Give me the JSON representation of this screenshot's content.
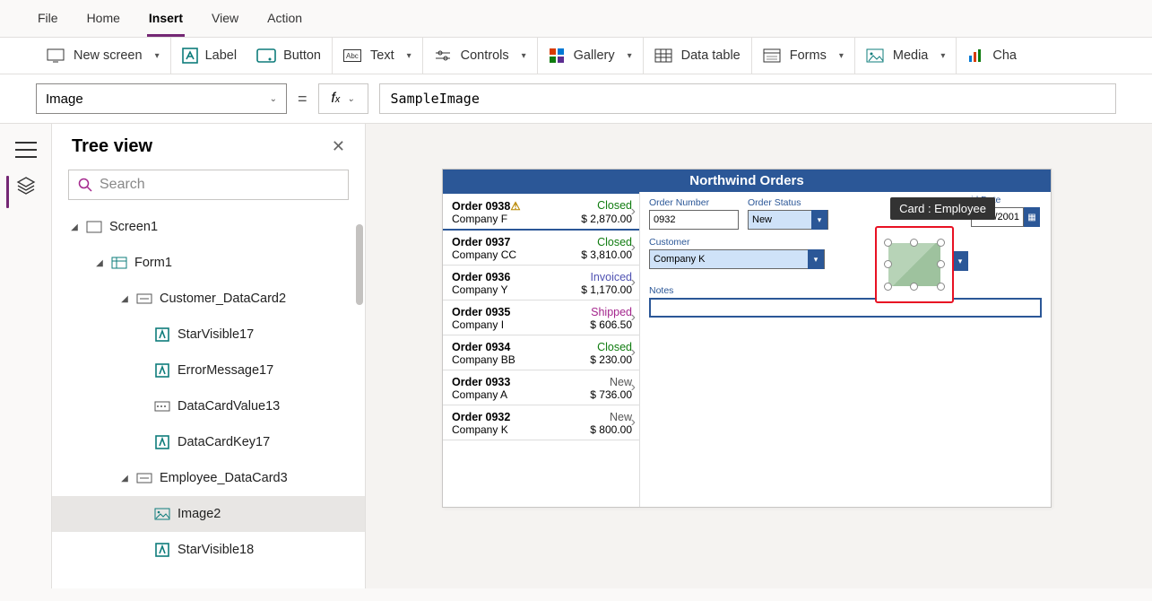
{
  "menu": {
    "file": "File",
    "home": "Home",
    "insert": "Insert",
    "view": "View",
    "action": "Action"
  },
  "ribbon": {
    "new_screen": "New screen",
    "label": "Label",
    "button": "Button",
    "text": "Text",
    "controls": "Controls",
    "gallery": "Gallery",
    "data_table": "Data table",
    "forms": "Forms",
    "media": "Media",
    "charts": "Cha"
  },
  "formula": {
    "property": "Image",
    "value": "SampleImage"
  },
  "tree": {
    "title": "Tree view",
    "search_placeholder": "Search",
    "items": {
      "screen1": "Screen1",
      "form1": "Form1",
      "customer_dc": "Customer_DataCard2",
      "starvisible17": "StarVisible17",
      "errormessage17": "ErrorMessage17",
      "datacardvalue13": "DataCardValue13",
      "datacardkey17": "DataCardKey17",
      "employee_dc": "Employee_DataCard3",
      "image2": "Image2",
      "starvisible18": "StarVisible18"
    }
  },
  "app": {
    "title": "Northwind Orders",
    "orders": [
      {
        "id": "Order 0938",
        "warn": true,
        "status": "Closed",
        "status_class": "closed",
        "company": "Company F",
        "amount": "$ 2,870.00"
      },
      {
        "id": "Order 0937",
        "status": "Closed",
        "status_class": "closed",
        "company": "Company CC",
        "amount": "$ 3,810.00"
      },
      {
        "id": "Order 0936",
        "status": "Invoiced",
        "status_class": "invoiced",
        "company": "Company Y",
        "amount": "$ 1,170.00"
      },
      {
        "id": "Order 0935",
        "status": "Shipped",
        "status_class": "shipped",
        "company": "Company I",
        "amount": "$ 606.50"
      },
      {
        "id": "Order 0934",
        "status": "Closed",
        "status_class": "closed",
        "company": "Company BB",
        "amount": "$ 230.00"
      },
      {
        "id": "Order 0933",
        "status": "New",
        "status_class": "new",
        "company": "Company A",
        "amount": "$ 736.00"
      },
      {
        "id": "Order 0932",
        "status": "New",
        "status_class": "new",
        "company": "Company K",
        "amount": "$ 800.00"
      }
    ],
    "detail": {
      "order_number_label": "Order Number",
      "order_number": "0932",
      "order_status_label": "Order Status",
      "order_status": "New",
      "paid_date_label": "id Date",
      "paid_date": "2/31/2001",
      "customer_label": "Customer",
      "customer": "Company K",
      "notes_label": "Notes",
      "tooltip": "Card : Employee"
    }
  }
}
